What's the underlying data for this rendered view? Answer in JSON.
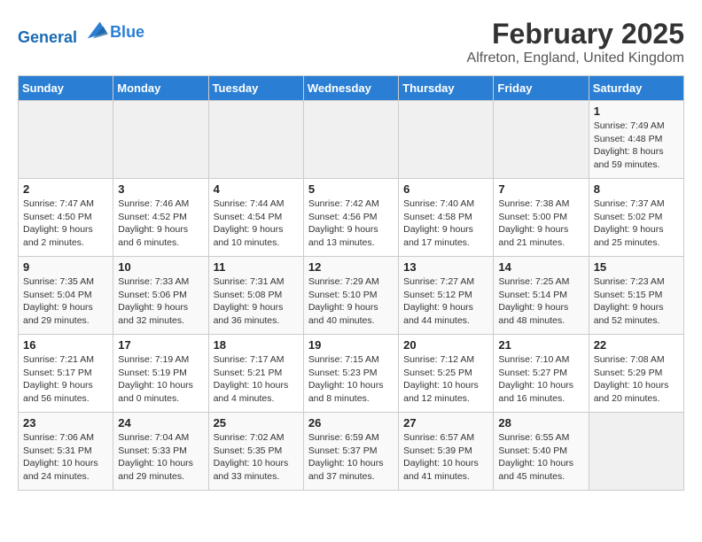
{
  "header": {
    "logo_line1": "General",
    "logo_line2": "Blue",
    "month": "February 2025",
    "location": "Alfreton, England, United Kingdom"
  },
  "weekdays": [
    "Sunday",
    "Monday",
    "Tuesday",
    "Wednesday",
    "Thursday",
    "Friday",
    "Saturday"
  ],
  "weeks": [
    [
      {
        "day": "",
        "info": ""
      },
      {
        "day": "",
        "info": ""
      },
      {
        "day": "",
        "info": ""
      },
      {
        "day": "",
        "info": ""
      },
      {
        "day": "",
        "info": ""
      },
      {
        "day": "",
        "info": ""
      },
      {
        "day": "1",
        "info": "Sunrise: 7:49 AM\nSunset: 4:48 PM\nDaylight: 8 hours and 59 minutes."
      }
    ],
    [
      {
        "day": "2",
        "info": "Sunrise: 7:47 AM\nSunset: 4:50 PM\nDaylight: 9 hours and 2 minutes."
      },
      {
        "day": "3",
        "info": "Sunrise: 7:46 AM\nSunset: 4:52 PM\nDaylight: 9 hours and 6 minutes."
      },
      {
        "day": "4",
        "info": "Sunrise: 7:44 AM\nSunset: 4:54 PM\nDaylight: 9 hours and 10 minutes."
      },
      {
        "day": "5",
        "info": "Sunrise: 7:42 AM\nSunset: 4:56 PM\nDaylight: 9 hours and 13 minutes."
      },
      {
        "day": "6",
        "info": "Sunrise: 7:40 AM\nSunset: 4:58 PM\nDaylight: 9 hours and 17 minutes."
      },
      {
        "day": "7",
        "info": "Sunrise: 7:38 AM\nSunset: 5:00 PM\nDaylight: 9 hours and 21 minutes."
      },
      {
        "day": "8",
        "info": "Sunrise: 7:37 AM\nSunset: 5:02 PM\nDaylight: 9 hours and 25 minutes."
      }
    ],
    [
      {
        "day": "9",
        "info": "Sunrise: 7:35 AM\nSunset: 5:04 PM\nDaylight: 9 hours and 29 minutes."
      },
      {
        "day": "10",
        "info": "Sunrise: 7:33 AM\nSunset: 5:06 PM\nDaylight: 9 hours and 32 minutes."
      },
      {
        "day": "11",
        "info": "Sunrise: 7:31 AM\nSunset: 5:08 PM\nDaylight: 9 hours and 36 minutes."
      },
      {
        "day": "12",
        "info": "Sunrise: 7:29 AM\nSunset: 5:10 PM\nDaylight: 9 hours and 40 minutes."
      },
      {
        "day": "13",
        "info": "Sunrise: 7:27 AM\nSunset: 5:12 PM\nDaylight: 9 hours and 44 minutes."
      },
      {
        "day": "14",
        "info": "Sunrise: 7:25 AM\nSunset: 5:14 PM\nDaylight: 9 hours and 48 minutes."
      },
      {
        "day": "15",
        "info": "Sunrise: 7:23 AM\nSunset: 5:15 PM\nDaylight: 9 hours and 52 minutes."
      }
    ],
    [
      {
        "day": "16",
        "info": "Sunrise: 7:21 AM\nSunset: 5:17 PM\nDaylight: 9 hours and 56 minutes."
      },
      {
        "day": "17",
        "info": "Sunrise: 7:19 AM\nSunset: 5:19 PM\nDaylight: 10 hours and 0 minutes."
      },
      {
        "day": "18",
        "info": "Sunrise: 7:17 AM\nSunset: 5:21 PM\nDaylight: 10 hours and 4 minutes."
      },
      {
        "day": "19",
        "info": "Sunrise: 7:15 AM\nSunset: 5:23 PM\nDaylight: 10 hours and 8 minutes."
      },
      {
        "day": "20",
        "info": "Sunrise: 7:12 AM\nSunset: 5:25 PM\nDaylight: 10 hours and 12 minutes."
      },
      {
        "day": "21",
        "info": "Sunrise: 7:10 AM\nSunset: 5:27 PM\nDaylight: 10 hours and 16 minutes."
      },
      {
        "day": "22",
        "info": "Sunrise: 7:08 AM\nSunset: 5:29 PM\nDaylight: 10 hours and 20 minutes."
      }
    ],
    [
      {
        "day": "23",
        "info": "Sunrise: 7:06 AM\nSunset: 5:31 PM\nDaylight: 10 hours and 24 minutes."
      },
      {
        "day": "24",
        "info": "Sunrise: 7:04 AM\nSunset: 5:33 PM\nDaylight: 10 hours and 29 minutes."
      },
      {
        "day": "25",
        "info": "Sunrise: 7:02 AM\nSunset: 5:35 PM\nDaylight: 10 hours and 33 minutes."
      },
      {
        "day": "26",
        "info": "Sunrise: 6:59 AM\nSunset: 5:37 PM\nDaylight: 10 hours and 37 minutes."
      },
      {
        "day": "27",
        "info": "Sunrise: 6:57 AM\nSunset: 5:39 PM\nDaylight: 10 hours and 41 minutes."
      },
      {
        "day": "28",
        "info": "Sunrise: 6:55 AM\nSunset: 5:40 PM\nDaylight: 10 hours and 45 minutes."
      },
      {
        "day": "",
        "info": ""
      }
    ]
  ]
}
